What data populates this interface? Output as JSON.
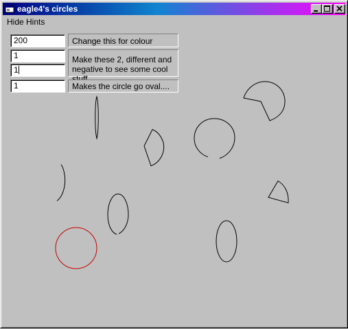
{
  "window": {
    "title": "eagle4's circles",
    "icon": "app-icon"
  },
  "titlebar_buttons": [
    "minimize-icon",
    "maximize-icon",
    "close-icon"
  ],
  "menu": {
    "hide_hints": "Hide Hints"
  },
  "inputs": {
    "colour": "200",
    "value_a": "1",
    "value_b": "1",
    "oval": "1"
  },
  "hints": {
    "colour": "Change this for colour",
    "cool_line1": "Make these 2, different and",
    "cool_line2": "negative to see some cool stuff",
    "oval": "Makes the circle go oval...."
  },
  "colors": {
    "arc_stroke": "#000000",
    "highlight_circle": "#c00000",
    "background": "#c0c0c0"
  }
}
